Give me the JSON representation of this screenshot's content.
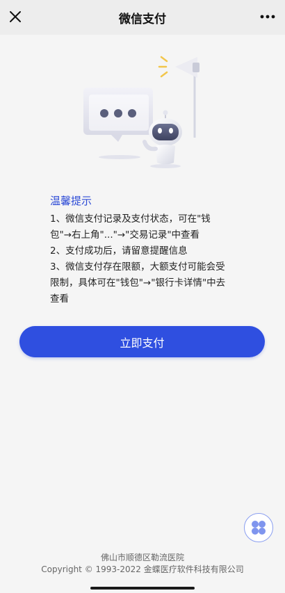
{
  "nav": {
    "title": "微信支付",
    "close_icon": "close-icon",
    "more_icon": "more-dots-icon"
  },
  "illustration": {
    "icon": "robot-chat-spotlight-illustration"
  },
  "tips": {
    "heading": "温馨提示",
    "lines": [
      "1、微信支付记录及支付状态，可在\"钱",
      "包\"→右上角\"...\"→\"交易记录\"中查看",
      "2、支付成功后，请留意提醒信息",
      "3、微信支付存在限额，大额支付可能会受",
      "限制，具体可在\"钱包\"→\"银行卡详情\"中去",
      "查看"
    ]
  },
  "pay_button": {
    "label": "立即支付"
  },
  "float_button": {
    "icon": "app-grid-icon"
  },
  "footer": {
    "org": "佛山市顺德区勒流医院",
    "copyright": "Copyright © 1993-2022 金蝶医疗软件科技有限公司"
  },
  "colors": {
    "accent": "#2f4fe0",
    "heading": "#2d4bd6",
    "background": "#f5f5f5",
    "nav_background": "#ededed"
  }
}
